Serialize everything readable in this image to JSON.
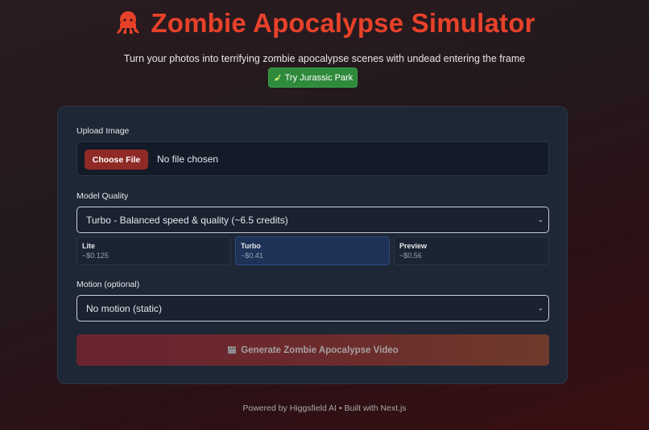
{
  "header": {
    "title": "Zombie Apocalypse Simulator",
    "title_icon": "octopus-icon",
    "subtitle": "Turn your photos into terrifying zombie apocalypse scenes with undead entering the frame",
    "alt_link_label": "Try Jurassic Park",
    "alt_link_icon": "dinosaur-icon"
  },
  "form": {
    "upload_label": "Upload Image",
    "choose_file_label": "Choose File",
    "no_file_text": "No file chosen",
    "model_quality_label": "Model Quality",
    "model_quality_selected": "Turbo - Balanced speed & quality (~6.5 credits)",
    "models": [
      {
        "name": "Lite",
        "price": "~$0.125",
        "selected": false
      },
      {
        "name": "Turbo",
        "price": "~$0.41",
        "selected": true
      },
      {
        "name": "Preview",
        "price": "~$0.56",
        "selected": false
      }
    ],
    "motion_label": "Motion (optional)",
    "motion_selected": "No motion (static)",
    "generate_label": "Generate Zombie Apocalypse Video",
    "generate_icon": "clapperboard-icon"
  },
  "footer": {
    "text": "Powered by Higgsfield AI • Built with Next.js"
  },
  "colors": {
    "accent": "#e8412a",
    "jurassic_button": "#2f8a3c",
    "choose_file_button": "#8f2a26",
    "selected_option": "#1e3157"
  }
}
